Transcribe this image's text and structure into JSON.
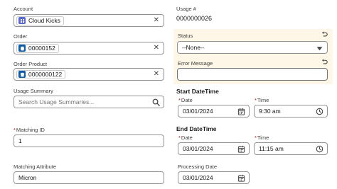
{
  "colors": {
    "account_icon_bg": "#5a67d8",
    "order_icon_bg": "#0b5cab",
    "highlight_bg": "#fef6e6",
    "required": "#ba0517"
  },
  "left": {
    "account": {
      "label": "Account",
      "value": "Cloud Kicks",
      "icon": "account-icon"
    },
    "order": {
      "label": "Order",
      "value": "00000152",
      "icon": "order-icon"
    },
    "order_product": {
      "label": "Order Product",
      "value": "0000000122",
      "icon": "order-icon"
    },
    "usage_summary": {
      "label": "Usage Summary",
      "placeholder": "Search Usage Summaries..."
    },
    "matching_id": {
      "required": "*",
      "label": "Matching ID",
      "value": "1"
    },
    "matching_attribute": {
      "label": "Matching Attribute",
      "value": "Micron"
    }
  },
  "right": {
    "usage_number": {
      "label": "Usage #",
      "value": "0000000026"
    },
    "status": {
      "label": "Status",
      "value": "--None--"
    },
    "error_message": {
      "label": "Error Message",
      "value": ""
    },
    "start": {
      "header": "Start DateTime",
      "date_required": "*",
      "date_label": "Date",
      "date_value": "03/01/2024",
      "time_required": "*",
      "time_label": "Time",
      "time_value": "9:30 am"
    },
    "end": {
      "header": "End DateTime",
      "date_required": "*",
      "date_label": "Date",
      "date_value": "03/01/2024",
      "time_required": "*",
      "time_label": "Time",
      "time_value": "11:15 am"
    },
    "processing_date": {
      "label": "Processing Date",
      "value": "03/01/2024"
    }
  }
}
